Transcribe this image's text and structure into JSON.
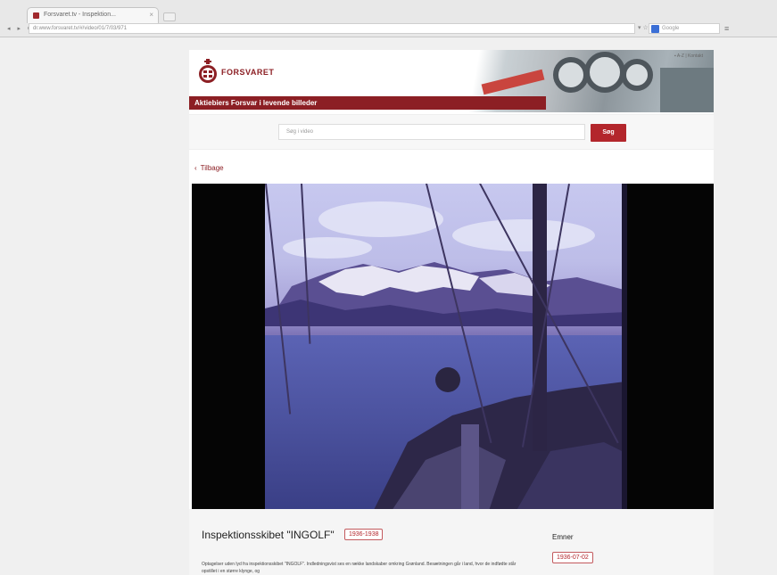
{
  "browser": {
    "tab_title": "Forsvaret.tv - Inspektion...",
    "tab_close": "×",
    "nav_icons": "◂ ▸ ⟳",
    "url": "dr.www.forsvaret.tv/#/video/01/7/03/971",
    "url_right": "▾ ☆",
    "search_placeholder": "Google",
    "menu_icon": "≡"
  },
  "site": {
    "logo_text": "FORSVARET",
    "header_top_text": "▪ A-Z | Kontakt",
    "header_bar_title": "Aktiebiers Forsvar i levende billeder",
    "search_placeholder": "Søg i video",
    "search_button": "Søg",
    "back_label": "Tilbage",
    "back_chevron": "‹"
  },
  "film": {
    "title": "Inspektionsskibet \"INGOLF\"",
    "years_tag": "1936-1938",
    "description": "Optagelser uden lyd fra inspektionsskibet \"INGOLF\". Indledningsvist ses en række landskaber omkring Grønland. Besætningen går i land, hvor de indfødte står opstillet i en større klynge, og",
    "emner_label": "Emner",
    "date_tag": "1936-07-02"
  },
  "colors": {
    "brand_red": "#8c1f24",
    "button_red": "#b3262c"
  }
}
